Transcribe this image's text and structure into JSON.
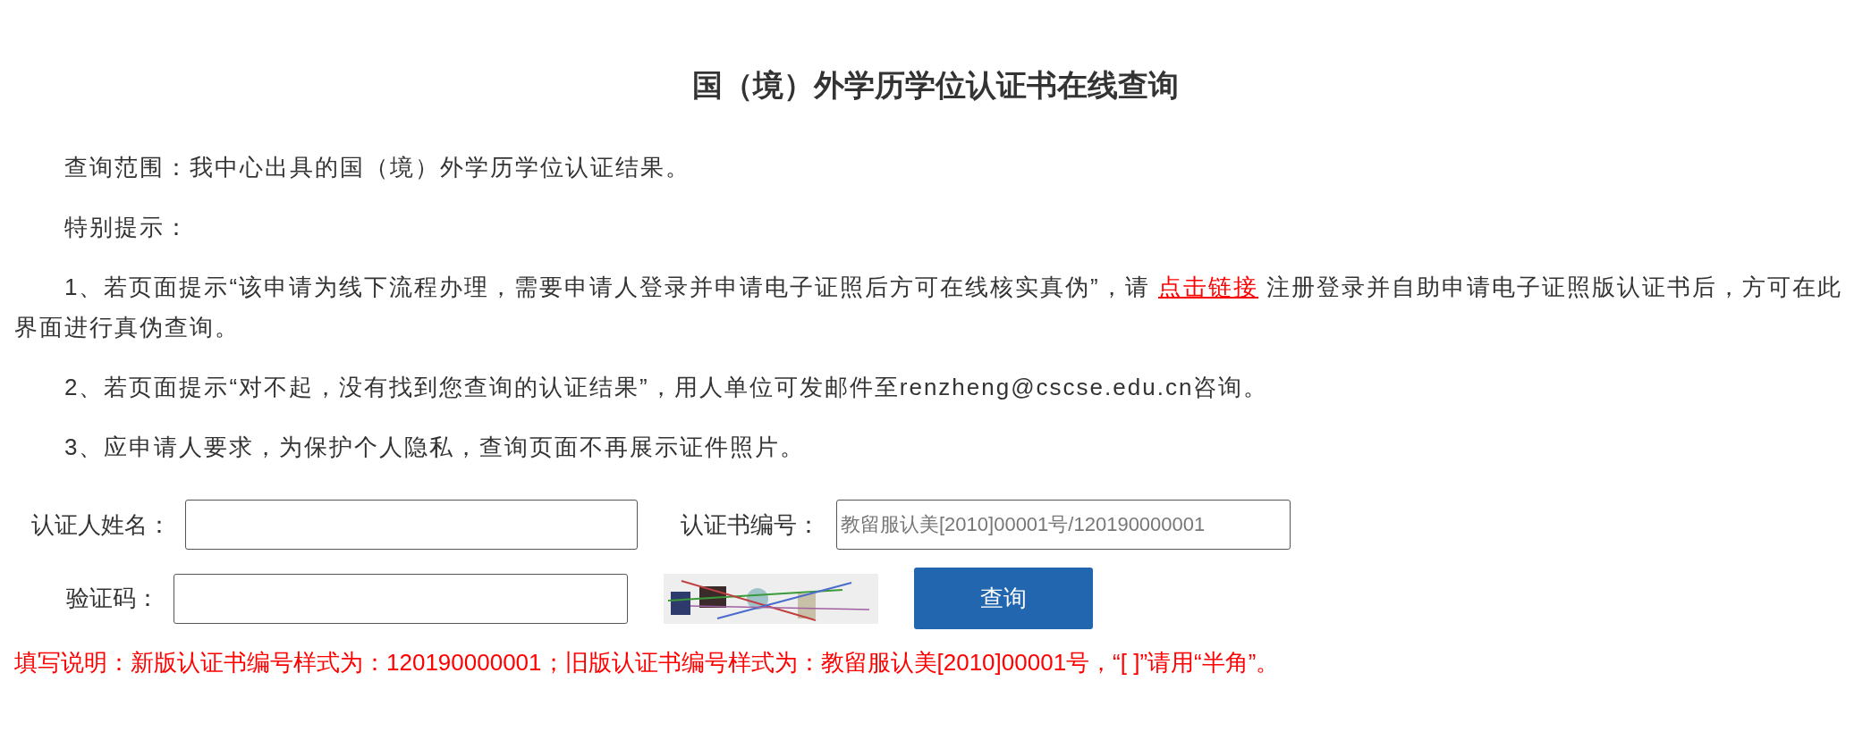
{
  "title": "国（境）外学历学位认证书在线查询",
  "notes": [
    {
      "before": "查询范围：我中心出具的国（境）外学历学位认证结果。"
    },
    {
      "before": "特别提示："
    },
    {
      "before": "1、若页面提示“该申请为线下流程办理，需要申请人登录并申请电子证照后方可在线核实真伪”，请 ",
      "link": "点击链接",
      "after": " 注册登录并自助申请电子证照版认证书后，方可在此界面进行真伪查询。"
    },
    {
      "before": "2、若页面提示“对不起，没有找到您查询的认证结果”，用人单位可发邮件至renzheng@cscse.edu.cn咨询。"
    },
    {
      "before": "3、应申请人要求，为保护个人隐私，查询页面不再展示证件照片。"
    }
  ],
  "form": {
    "name_label": "认证人姓名：",
    "cert_label": "认证书编号：",
    "cert_placeholder": "教留服认美[2010]00001号/120190000001",
    "captcha_label": "验证码：",
    "submit": "查询"
  },
  "instructions": "填写说明：新版认证书编号样式为：120190000001；旧版认证书编号样式为：教留服认美[2010]00001号，“[ ]”请用“半角”。"
}
